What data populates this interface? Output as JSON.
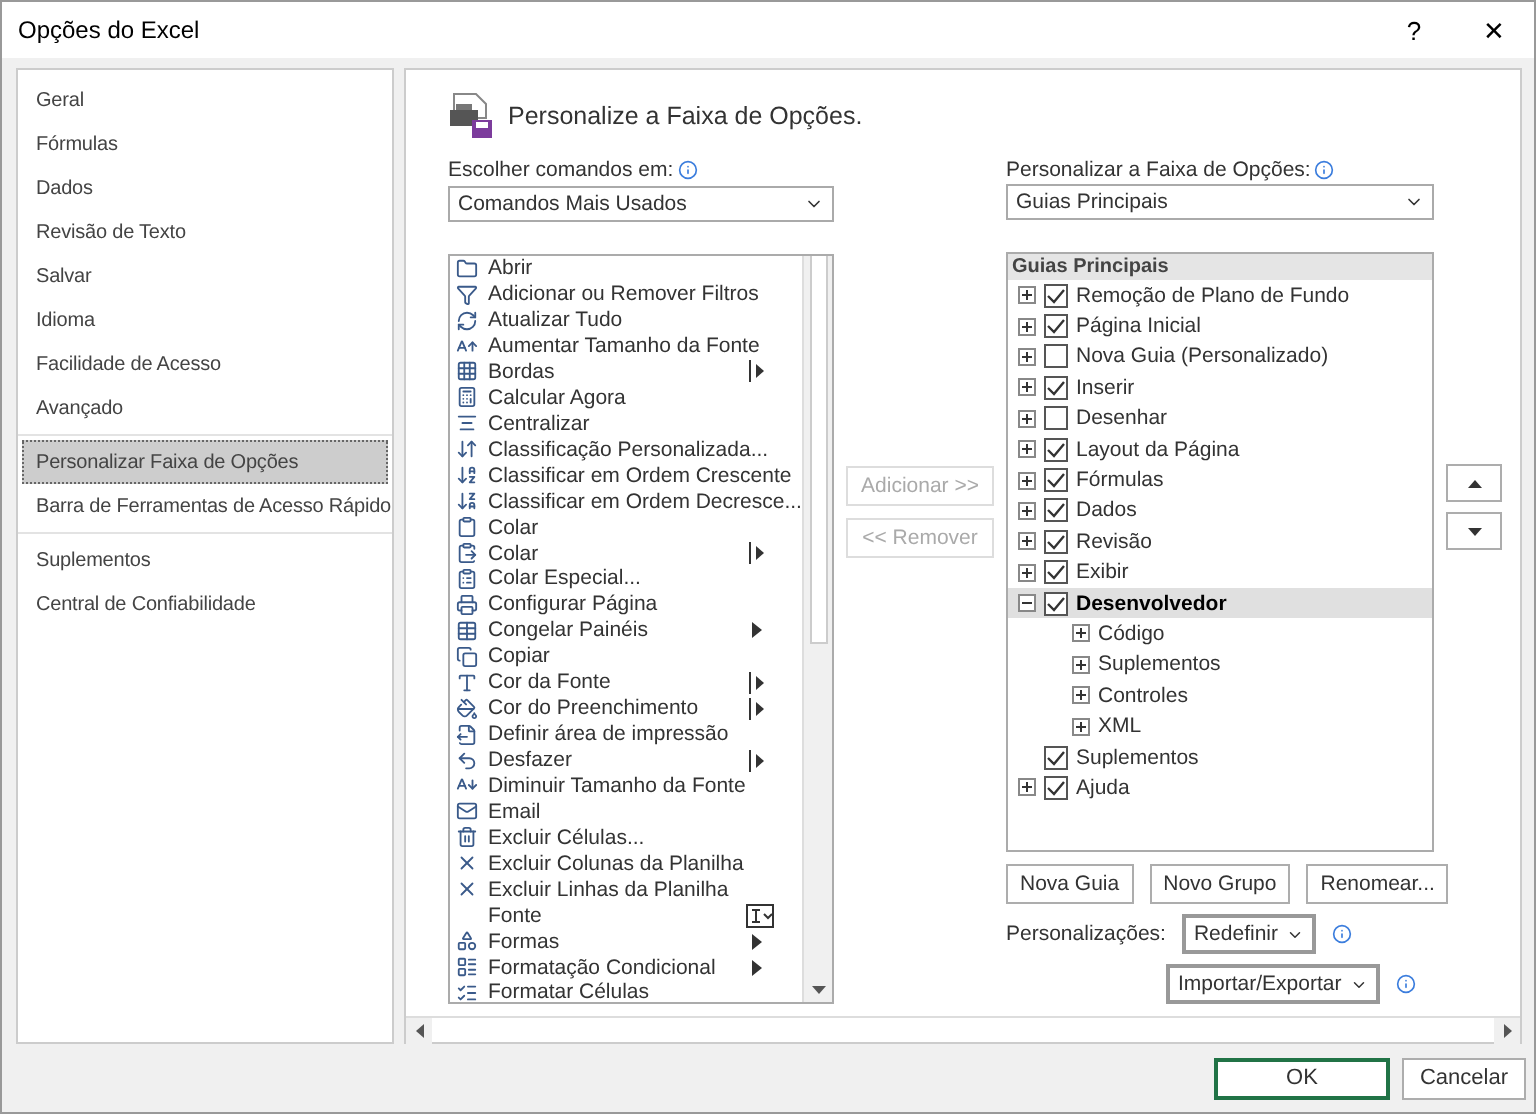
{
  "window": {
    "title": "Opções do Excel",
    "help": "?",
    "close": "✕"
  },
  "sidebar": {
    "groups": [
      [
        {
          "label": "Geral",
          "selected": false
        },
        {
          "label": "Fórmulas",
          "selected": false
        },
        {
          "label": "Dados",
          "selected": false
        },
        {
          "label": "Revisão de Texto",
          "selected": false
        },
        {
          "label": "Salvar",
          "selected": false
        },
        {
          "label": "Idioma",
          "selected": false
        },
        {
          "label": "Facilidade de Acesso",
          "selected": false
        },
        {
          "label": "Avançado",
          "selected": false
        }
      ],
      [
        {
          "label": "Personalizar Faixa de Opções",
          "selected": true
        },
        {
          "label": "Barra de Ferramentas de Acesso Rápido",
          "selected": false
        }
      ],
      [
        {
          "label": "Suplementos",
          "selected": false
        },
        {
          "label": "Central de Confiabilidade",
          "selected": false
        }
      ]
    ]
  },
  "heading": "Personalize a Faixa de Opções.",
  "commands": {
    "label": "Escolher comandos em:",
    "dropdown": "Comandos Mais Usados",
    "items": [
      {
        "label": "Abrir",
        "kind": "plain"
      },
      {
        "label": "Adicionar ou Remover Filtros",
        "kind": "plain"
      },
      {
        "label": "Atualizar Tudo",
        "kind": "plain"
      },
      {
        "label": "Aumentar Tamanho da Fonte",
        "kind": "plain"
      },
      {
        "label": "Bordas",
        "kind": "split"
      },
      {
        "label": "Calcular Agora",
        "kind": "plain"
      },
      {
        "label": "Centralizar",
        "kind": "plain"
      },
      {
        "label": "Classificação Personalizada...",
        "kind": "plain"
      },
      {
        "label": "Classificar em Ordem Crescente",
        "kind": "plain"
      },
      {
        "label": "Classificar em Ordem Decresce...",
        "kind": "plain"
      },
      {
        "label": "Colar",
        "kind": "plain"
      },
      {
        "label": "Colar",
        "kind": "split"
      },
      {
        "label": "Colar Especial...",
        "kind": "plain"
      },
      {
        "label": "Configurar Página",
        "kind": "plain"
      },
      {
        "label": "Congelar Painéis",
        "kind": "arrow"
      },
      {
        "label": "Copiar",
        "kind": "plain"
      },
      {
        "label": "Cor da Fonte",
        "kind": "split"
      },
      {
        "label": "Cor do Preenchimento",
        "kind": "split"
      },
      {
        "label": "Definir área de impressão",
        "kind": "plain"
      },
      {
        "label": "Desfazer",
        "kind": "split"
      },
      {
        "label": "Diminuir Tamanho da Fonte",
        "kind": "plain"
      },
      {
        "label": "Email",
        "kind": "plain"
      },
      {
        "label": "Excluir Células...",
        "kind": "plain"
      },
      {
        "label": "Excluir Colunas da Planilha",
        "kind": "plain"
      },
      {
        "label": "Excluir Linhas da Planilha",
        "kind": "plain"
      },
      {
        "label": "Fonte",
        "kind": "field"
      },
      {
        "label": "Formas",
        "kind": "arrow"
      },
      {
        "label": "Formatação Condicional",
        "kind": "arrow"
      },
      {
        "label": "Formatar Células",
        "kind": "plain"
      }
    ]
  },
  "add_button": {
    "label": "Adicionar >>",
    "disabled": true
  },
  "remove_button": {
    "label": "<< Remover",
    "disabled": true
  },
  "ribbon": {
    "label": "Personalizar a Faixa de Opções:",
    "dropdown": "Guias Principais",
    "header": "Guias Principais",
    "tabs": [
      {
        "label": "Remoção de Plano de Fundo",
        "kind": "expandable",
        "expanded": false,
        "checked": true,
        "selected": false
      },
      {
        "label": "Página Inicial",
        "kind": "expandable",
        "expanded": false,
        "checked": true,
        "selected": false
      },
      {
        "label": "Nova Guia (Personalizado)",
        "kind": "expandable",
        "expanded": false,
        "checked": false,
        "selected": false
      },
      {
        "label": "Inserir",
        "kind": "expandable",
        "expanded": false,
        "checked": true,
        "selected": false
      },
      {
        "label": "Desenhar",
        "kind": "expandable",
        "expanded": false,
        "checked": false,
        "selected": false
      },
      {
        "label": "Layout da Página",
        "kind": "expandable",
        "expanded": false,
        "checked": true,
        "selected": false
      },
      {
        "label": "Fórmulas",
        "kind": "expandable",
        "expanded": false,
        "checked": true,
        "selected": false
      },
      {
        "label": "Dados",
        "kind": "expandable",
        "expanded": false,
        "checked": true,
        "selected": false
      },
      {
        "label": "Revisão",
        "kind": "expandable",
        "expanded": false,
        "checked": true,
        "selected": false
      },
      {
        "label": "Exibir",
        "kind": "expandable",
        "expanded": false,
        "checked": true,
        "selected": false
      },
      {
        "label": "Desenvolvedor",
        "kind": "expandable",
        "expanded": true,
        "checked": true,
        "selected": true,
        "children": [
          {
            "label": "Código",
            "kind": "expandable",
            "expanded": false
          },
          {
            "label": "Suplementos",
            "kind": "expandable",
            "expanded": false
          },
          {
            "label": "Controles",
            "kind": "expandable",
            "expanded": false
          },
          {
            "label": "XML",
            "kind": "expandable",
            "expanded": false
          }
        ]
      },
      {
        "label": "Suplementos",
        "kind": "leaf",
        "checked": true,
        "selected": false
      },
      {
        "label": "Ajuda",
        "kind": "expandable",
        "expanded": false,
        "checked": true,
        "selected": false
      }
    ],
    "buttons": [
      "Nova Guia",
      "Novo Grupo",
      "Renomear..."
    ],
    "customizations_label": "Personalizações:",
    "reset": "Redefinir",
    "import_export": "Importar/Exportar"
  },
  "footer": {
    "ok": "OK",
    "cancel": "Cancelar"
  }
}
